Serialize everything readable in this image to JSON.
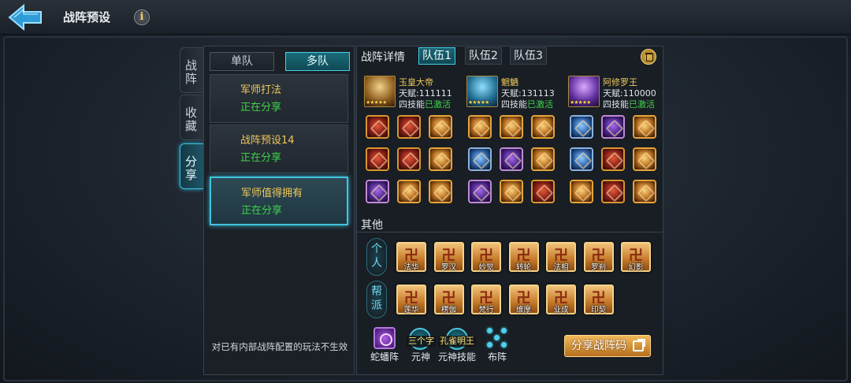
{
  "header": {
    "title": "战阵预设"
  },
  "side_tabs": [
    {
      "label": "战阵",
      "active": false
    },
    {
      "label": "收藏",
      "active": false
    },
    {
      "label": "分享",
      "active": true
    }
  ],
  "team_mode": {
    "single": "单队",
    "multi": "多队",
    "selected": "multi"
  },
  "plans": [
    {
      "name": "军师打法",
      "status": "正在分享",
      "selected": false
    },
    {
      "name": "战阵预设14",
      "status": "正在分享",
      "selected": false
    },
    {
      "name": "军师值得拥有",
      "status": "正在分享",
      "selected": true
    }
  ],
  "left_note": "对已有内部战阵配置的玩法不生效",
  "detail": {
    "label": "战阵详情",
    "tabs": [
      {
        "label": "队伍1",
        "active": true
      },
      {
        "label": "队伍2",
        "active": false
      },
      {
        "label": "队伍3",
        "active": false
      }
    ]
  },
  "heroes": [
    {
      "name": "玉皇大帝",
      "talent": "天赋:111111",
      "skill_prefix": "四技能",
      "skill_status": "已激活",
      "stars": "★★★★★"
    },
    {
      "name": "魍魉",
      "talent": "天赋:131113",
      "skill_prefix": "四技能",
      "skill_status": "已激活",
      "stars": "★★★★★"
    },
    {
      "name": "阿修罗王",
      "talent": "天赋:110000",
      "skill_prefix": "四技能",
      "skill_status": "已激活",
      "stars": "★★★★★"
    }
  ],
  "equipment_colors": [
    [
      "red",
      "red",
      "gold",
      "gold",
      "gold",
      "gold",
      "blue",
      "purple",
      "gold"
    ],
    [
      "red",
      "red",
      "gold",
      "blue",
      "purple",
      "gold",
      "blue",
      "red",
      "gold"
    ],
    [
      "purple",
      "gold",
      "gold",
      "purple",
      "gold",
      "red",
      "gold",
      "red",
      "gold"
    ]
  ],
  "other": {
    "label": "其他",
    "personal_label": "个人",
    "guild_label": "帮派",
    "personal_skills": [
      "法华",
      "罗汉",
      "妙觉",
      "转轮",
      "法相",
      "罗刹",
      "幻影"
    ],
    "guild_skills": [
      "莲华",
      "楞伽",
      "梵行",
      "维摩",
      "业成",
      "印契"
    ]
  },
  "bottom": {
    "formation_label": "蛇蟠阵",
    "spirit_label": "元神",
    "spirit_tag": "三个字",
    "spirit_skill_label": "元神技能",
    "spirit_skill_tag": "孔雀明王",
    "layout_label": "布阵",
    "share_button": "分享战阵码"
  },
  "colors": {
    "accent": "#42c3dd",
    "gold_text": "#f0c85a",
    "green_text": "#3fd24a"
  }
}
